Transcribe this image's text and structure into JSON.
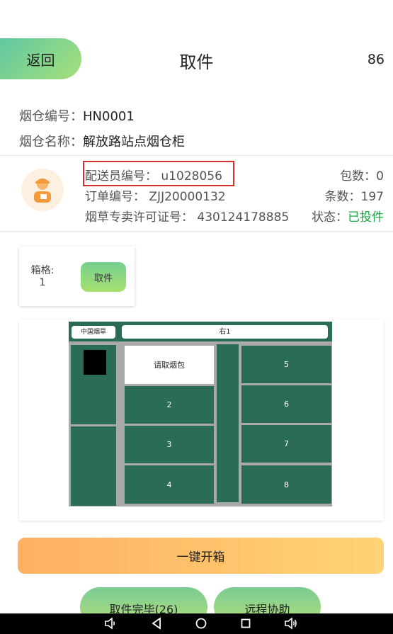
{
  "header": {
    "back_label": "返回",
    "title": "取件",
    "countdown": "86"
  },
  "cabinet_info": {
    "code_label": "烟仓编号：",
    "code_value": "HN0001",
    "name_label": "烟仓名称：",
    "name_value": "解放路站点烟仓柜"
  },
  "courier": {
    "id_label": "配送员编号：",
    "id_value": "u1028056",
    "order_label": "订单编号：",
    "order_value": "ZJJ20000132",
    "license_label": "烟草专卖许可证号：",
    "license_value": "430124178885",
    "bags_label": "包数：",
    "bags_value": "0",
    "items_label": "条数：",
    "items_value": "197",
    "status_label": "状态：",
    "status_value": "已投件",
    "status_color": "#19a845"
  },
  "box": {
    "label": "箱格:",
    "number": "1",
    "take_label": "取件"
  },
  "cabinet_diagram": {
    "brand": "中国烟草",
    "side": "右1",
    "prompt": "请取烟包",
    "cells": [
      "2",
      "3",
      "4",
      "5",
      "6",
      "7",
      "8"
    ],
    "cell_color": "#2a6c56"
  },
  "actions": {
    "open_all": "一键开箱",
    "done": "取件完毕(26)",
    "remote": "远程协助"
  },
  "navbar": {
    "icons": [
      "volume-down-icon",
      "back-triangle-icon",
      "home-circle-icon",
      "recents-square-icon",
      "volume-up-icon"
    ]
  }
}
